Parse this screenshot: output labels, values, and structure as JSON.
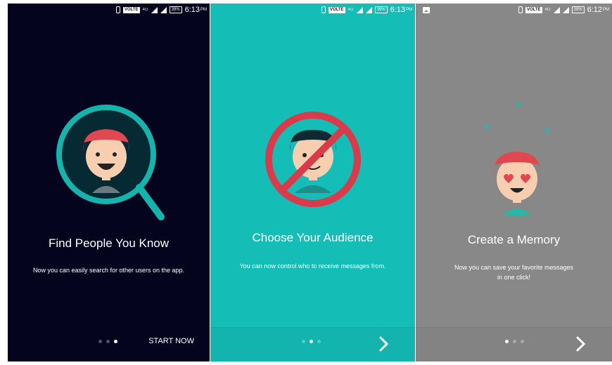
{
  "screens": [
    {
      "status": {
        "volte": "VOLTE",
        "net": "4G",
        "battery": "39%",
        "time": "6:13",
        "ampm": "PM"
      },
      "title": "Find People You Know",
      "description": "Now you can easily search for other users on the app.",
      "dots_active_index": 2,
      "action_label": "START NOW",
      "colors": {
        "background": "#04041e",
        "accent": "#16b3ad"
      }
    },
    {
      "status": {
        "volte": "VOLTE",
        "net": "4G",
        "battery": "39%",
        "time": "6:13",
        "ampm": "PM"
      },
      "title": "Choose Your Audience",
      "description": "You can now control who to receive messages from.",
      "dots_active_index": 1,
      "action_icon": "chevron-right-icon",
      "colors": {
        "background": "#14bdb6",
        "accent": "#d93b4a"
      }
    },
    {
      "status": {
        "volte": "VOLTE",
        "net": "4G",
        "battery": "39%",
        "time": "6:12",
        "ampm": "PM"
      },
      "title": "Create a Memory",
      "description_line1": "Now you can save your favorite messages",
      "description_line2": "in one click!",
      "dots_active_index": 0,
      "action_icon": "chevron-right-icon",
      "colors": {
        "background": "#888888",
        "accent": "#2bb5a8"
      }
    }
  ]
}
